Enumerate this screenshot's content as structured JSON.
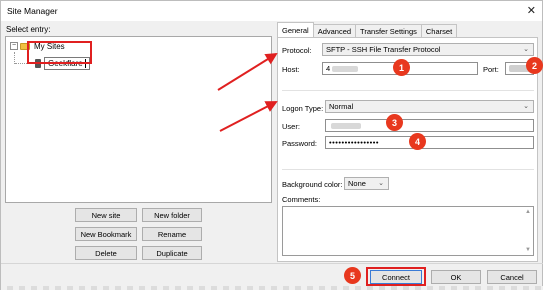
{
  "window": {
    "title": "Site Manager",
    "close_icon": "close-icon"
  },
  "left": {
    "select_label": "Select entry:",
    "tree": {
      "root_label": "My Sites",
      "site_label": "Geekflare"
    },
    "buttons": {
      "new_site": "New site",
      "new_folder": "New folder",
      "new_bookmark": "New Bookmark",
      "rename": "Rename",
      "delete": "Delete",
      "duplicate": "Duplicate"
    }
  },
  "tabs": [
    "General",
    "Advanced",
    "Transfer Settings",
    "Charset"
  ],
  "general": {
    "protocol_label": "Protocol:",
    "protocol_value": "SFTP - SSH File Transfer Protocol",
    "host_label": "Host:",
    "host_value": "4",
    "port_label": "Port:",
    "logon_type_label": "Logon Type:",
    "logon_type_value": "Normal",
    "user_label": "User:",
    "password_label": "Password:",
    "password_value": "••••••••••••••••",
    "bg_color_label": "Background color:",
    "bg_color_value": "None",
    "comments_label": "Comments:"
  },
  "footer": {
    "connect": "Connect",
    "ok": "OK",
    "cancel": "Cancel"
  },
  "annotations": {
    "badges": [
      "1",
      "2",
      "3",
      "4",
      "5"
    ],
    "highlight_color": "#e8381e"
  }
}
